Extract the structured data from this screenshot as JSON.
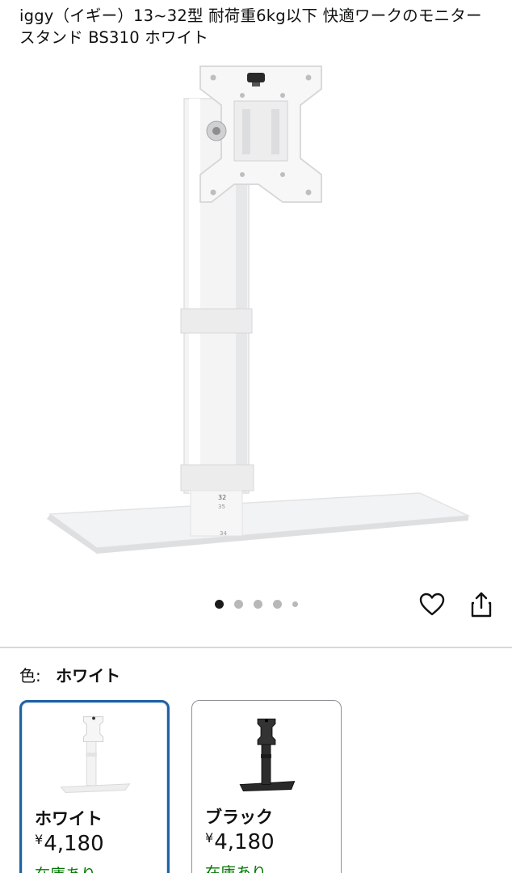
{
  "product": {
    "title": "iggy（イギー）13~32型 耐荷重6kg以下 快適ワークのモニタースタンド BS310 ホワイト"
  },
  "gallery": {
    "image_count": 5,
    "active_index": 0,
    "pole_labels": [
      "32",
      "35",
      "34"
    ]
  },
  "actions": {
    "favorite_icon": "heart-icon",
    "share_icon": "share-icon"
  },
  "color_selector": {
    "label": "色:",
    "selected_value": "ホワイト",
    "options": [
      {
        "name": "ホワイト",
        "yen": "¥",
        "price": "4,180",
        "stock": "在庫あり",
        "selected": true
      },
      {
        "name": "ブラック",
        "yen": "¥",
        "price": "4,180",
        "stock": "在庫あり",
        "selected": false
      }
    ]
  },
  "colors": {
    "selected_border": "#2162a1",
    "in_stock_green": "#007600",
    "divider": "#d5d9d9"
  }
}
